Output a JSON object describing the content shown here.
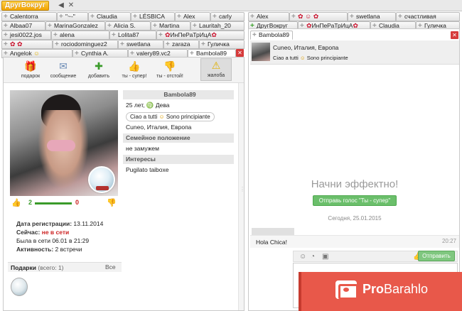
{
  "brand": "ДругВокруг",
  "left_tabs": [
    [
      "Calentorra",
      "\"~-\"",
      "Claudia",
      "LÉSBICA",
      "Alex",
      "carly"
    ],
    [
      "Albaa07",
      "MarinaGonzalez",
      "Alicia S.",
      "Martina",
      "Lauritah_20"
    ],
    [
      "jesi0022.jos",
      "alena",
      "Lolita87",
      "ИнПеРаТрИцА"
    ],
    [
      "",
      "rociodominguez2",
      "swetlana",
      "zaraza",
      "Гуличка"
    ],
    [
      "Angelok",
      "Cynthia A.",
      "valery89.vc2",
      "Bambola89"
    ]
  ],
  "right_tabs": [
    [
      "Alex",
      "",
      "swetlana",
      "счастливая"
    ],
    [
      "ДругВокруг",
      "ИнПеРаТрИцА",
      "Claudia",
      "Гуличка"
    ],
    [
      "Bambola89"
    ]
  ],
  "actions": [
    "подарок",
    "сообщение",
    "добавить",
    "ты - супер!",
    "ты - отстой!",
    "жалоба"
  ],
  "profile": {
    "name": "Bambola89",
    "age_sign": "25 лет,",
    "zodiac": "Дева",
    "status_text": "Ciao a tutti",
    "status_tail": "Sono principiante",
    "location": "Cuneo, Италия, Европа",
    "family_header": "Семейное положение",
    "family_value": "не замужем",
    "interests_header": "Интересы",
    "interests_value": "Pugilato taiboxe",
    "votes_up": "2",
    "votes_down": "0"
  },
  "stats": {
    "reg_label": "Дата регистрации:",
    "reg_value": "13.11.2014",
    "now_label": "Сейчас:",
    "now_value": "не в сети",
    "last_label": "Была в сети",
    "last_value": "06.01 в 21:29",
    "activity_label": "Активность:",
    "activity_value": "2 встречи"
  },
  "gifts": {
    "label": "Подарки",
    "count": "(всего: 1)",
    "all": "Все"
  },
  "chat": {
    "location": "Cuneo, Италия, Европа",
    "status_text": "Ciao a tutti",
    "status_tail": "Sono principiante",
    "cta_title": "Начни эффектно!",
    "cta_button": "Отправь голос \"Ты - супер\"",
    "date": "Сегодня, 25.01.2015",
    "message": "Hola Chica!",
    "message_time": "20:27",
    "send": "Отправить"
  },
  "promo": {
    "brand_bold": "Pro",
    "brand_rest": "Barahlo"
  },
  "colors": {
    "accent": "#f2a300",
    "green": "#3a9b2a",
    "red": "#cc2222",
    "promo": "#e8584a"
  }
}
